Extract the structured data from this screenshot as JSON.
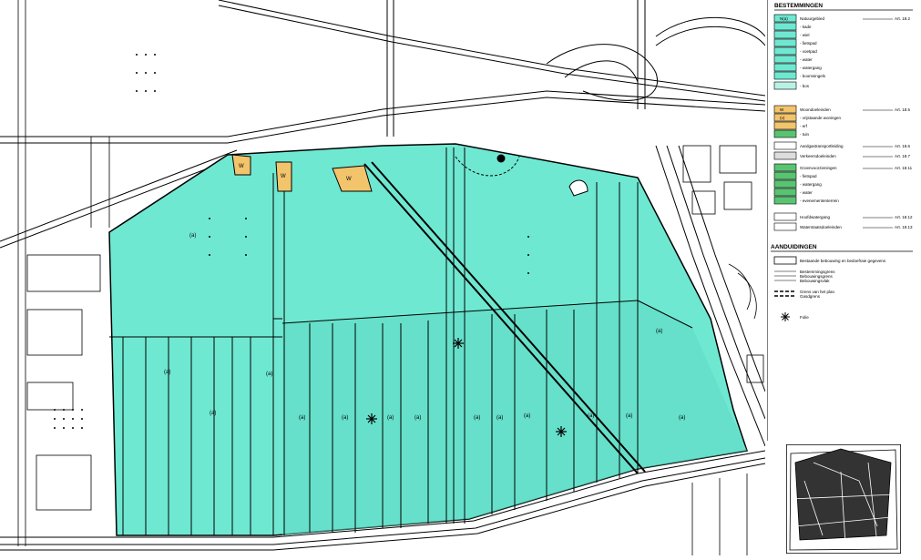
{
  "legend": {
    "heading_bestemmingen": "BESTEMMINGEN",
    "heading_aanduidingen": "AANDUIDINGEN",
    "colors": {
      "nature": "#6fe8d2",
      "nature_dark": "#5fd9c3",
      "residential": "#f2c46b",
      "green": "#58c472",
      "line": "#000000"
    },
    "items": [
      {
        "code": "N(a)",
        "label": "Natuurgebied",
        "art": "Art. 18.2",
        "swatch": "nature"
      },
      {
        "code": "",
        "label": "- kade",
        "art": "",
        "swatch": "kade"
      },
      {
        "code": "",
        "label": "- wiel",
        "art": "",
        "swatch": "wiel"
      },
      {
        "code": "",
        "label": "- fietspad",
        "art": "",
        "swatch": "fietspad"
      },
      {
        "code": "",
        "label": "- voetpad",
        "art": "",
        "swatch": "voetpad"
      },
      {
        "code": "",
        "label": "- water",
        "art": "",
        "swatch": "water"
      },
      {
        "code": "",
        "label": "- watergang",
        "art": "",
        "swatch": "watergang"
      },
      {
        "code": "",
        "label": "- boomsingels",
        "art": "",
        "swatch": "boomsingels"
      },
      {
        "code": "",
        "label": "- bos",
        "art": "",
        "swatch": "bos"
      },
      {
        "code": "W",
        "label": "Woondoeleinden",
        "art": "Art. 18.5",
        "swatch": "woon"
      },
      {
        "code": "(v)",
        "label": "- vrijstaande woningen",
        "art": "",
        "swatch": "woon"
      },
      {
        "code": "",
        "label": "- erf",
        "art": "",
        "swatch": "erf"
      },
      {
        "code": "",
        "label": "- tuin",
        "art": "",
        "swatch": "tuin"
      },
      {
        "code": "",
        "label": "Aardgastransportleiding",
        "art": "Art. 18.6",
        "swatch": "gas"
      },
      {
        "code": "",
        "label": "Verkeersdoeleinden",
        "art": "Art. 18.7",
        "swatch": "verkeer"
      },
      {
        "code": "",
        "label": "Groenvoorzieningen",
        "art": "Art. 18.11",
        "swatch": "groen"
      },
      {
        "code": "",
        "label": "- fietspad",
        "art": "",
        "swatch": "groen"
      },
      {
        "code": "",
        "label": "- watergang",
        "art": "",
        "swatch": "groen"
      },
      {
        "code": "",
        "label": "- water",
        "art": "",
        "swatch": "groen"
      },
      {
        "code": "",
        "label": "- evenemententerrein",
        "art": "",
        "swatch": "groen"
      },
      {
        "code": "",
        "label": "Hoofdwatergang",
        "art": "Art. 18.12",
        "swatch": "hoofdwater"
      },
      {
        "code": "",
        "label": "Waterstaatsdoeleinden",
        "art": "Art. 18.13",
        "swatch": "waterstaat"
      }
    ],
    "aanduidingen": [
      {
        "label": "Bestaande bebouwing en bedoefraie gegevens",
        "swatch": "bebouwing"
      },
      {
        "label": "Bestemmingsgrens",
        "swatch": "grens"
      },
      {
        "label": "Bebouwingsgrens",
        "swatch": "grens"
      },
      {
        "label": "Bebouwingsvlak",
        "swatch": "grens"
      },
      {
        "label": "Grens van het plan",
        "swatch": "plangrens"
      },
      {
        "label": "Gasdgrens",
        "swatch": "plangrens"
      },
      {
        "label": "Folie",
        "swatch": "folie"
      }
    ]
  },
  "map": {
    "parcel_labels": [
      "(a)",
      "(a)",
      "(a)",
      "(a)",
      "(a)",
      "(a)",
      "(a)",
      "(a)",
      "(a)",
      "(a)",
      "(a)",
      "(a)",
      "(a)",
      "(a)",
      "(a)"
    ],
    "house_labels": [
      "W",
      "W",
      "W"
    ],
    "icon_name": "folie-marker-icon"
  }
}
